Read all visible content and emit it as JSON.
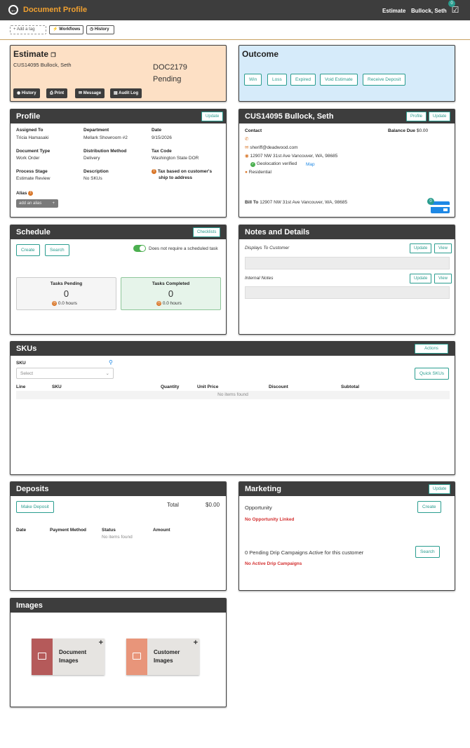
{
  "header": {
    "title": "Document Profile",
    "doc_type": "Estimate",
    "user": "Bullock, Seth",
    "notifications": "0"
  },
  "toolbar": {
    "add_tag": "+ Add a tag",
    "workflows": "Workflows",
    "history": "History"
  },
  "estimate": {
    "title": "Estimate",
    "customer": "CUS14095 Bullock, Seth",
    "doc_number": "DOC2179",
    "status": "Pending",
    "buttons": {
      "history": "History",
      "print": "Print",
      "message": "Message",
      "audit_log": "Audit Log"
    },
    "bg_color": "#fde0c5"
  },
  "outcome": {
    "title": "Outcome",
    "buttons": {
      "win": "Win",
      "loss": "Loss",
      "expired": "Expired",
      "void": "Void Estimate",
      "deposit": "Receive Deposit"
    },
    "bg_color": "#d6ebfa"
  },
  "profile": {
    "title": "Profile",
    "update": "Update",
    "assigned_to_label": "Assigned To",
    "assigned_to": "Tricia Hamasaki",
    "department_label": "Department",
    "department": "Mellark Showroom #2",
    "date_label": "Date",
    "date": "9/15/2026",
    "doc_type_label": "Document Type",
    "doc_type": "Work Order",
    "dist_label": "Distribution Method",
    "dist": "Delivery",
    "tax_label": "Tax Code",
    "tax": "Washington State DOR",
    "stage_label": "Process Stage",
    "stage": "Estimate Review",
    "desc_label": "Description",
    "desc": "No SKUs",
    "tax_note_line1": "Tax based on customer's",
    "tax_note_line2": "ship to address",
    "alias_label": "Alias",
    "add_alias": "add an alias"
  },
  "customer": {
    "title": "CUS14095 Bullock, Seth",
    "profile_btn": "Profile",
    "update_btn": "Update",
    "contact_label": "Contact",
    "balance_label": "Balance Due",
    "balance": "$0.00",
    "email": "sheriff@deadwood.com",
    "address": "12907 NW 31st Ave Vancouver, WA, 98685",
    "geo": "Geolocation verified",
    "map": "Map",
    "type": "Residential",
    "bill_to_label": "Bill To",
    "bill_to": "12907 NW 31st Ave Vancouver, WA, 98685",
    "card_count": "0"
  },
  "schedule": {
    "title": "Schedule",
    "checklists": "Checklists",
    "create": "Create",
    "search": "Search",
    "toggle_label": "Does not require a scheduled task",
    "pending_label": "Tasks Pending",
    "pending_count": "0",
    "pending_hours": "0.0 hours",
    "completed_label": "Tasks Completed",
    "completed_count": "0",
    "completed_hours": "0.0 hours"
  },
  "notes": {
    "title": "Notes and Details",
    "displays_label": "Displays To Customer",
    "internal_label": "Internal Notes",
    "update": "Update",
    "view": "View"
  },
  "skus": {
    "title": "SKUs",
    "actions": "Actions",
    "sku_label": "SKU",
    "select_placeholder": "Select",
    "quick_skus": "Quick SKUs",
    "columns": [
      "Line",
      "SKU",
      "Quantity",
      "Unit Price",
      "Discount",
      "Subtotal"
    ],
    "empty": "No items found"
  },
  "deposits": {
    "title": "Deposits",
    "make_deposit": "Make Deposit",
    "total_label": "Total",
    "total": "$0.00",
    "columns": [
      "Date",
      "Payment Method",
      "Status",
      "Amount"
    ],
    "empty": "No items found"
  },
  "marketing": {
    "title": "Marketing",
    "update": "Update",
    "opportunity_label": "Opportunity",
    "create": "Create",
    "no_opportunity": "No Opportunity Linked",
    "drip_label": "0 Pending Drip Campaigns Active for this customer",
    "search": "Search",
    "no_drip": "No Active Drip Campaigns"
  },
  "images": {
    "title": "Images",
    "doc_line1": "Document",
    "doc_line2": "Images",
    "cust_line1": "Customer",
    "cust_line2": "Images",
    "doc_color": "#b55a5a",
    "cust_color": "#e8957a"
  }
}
